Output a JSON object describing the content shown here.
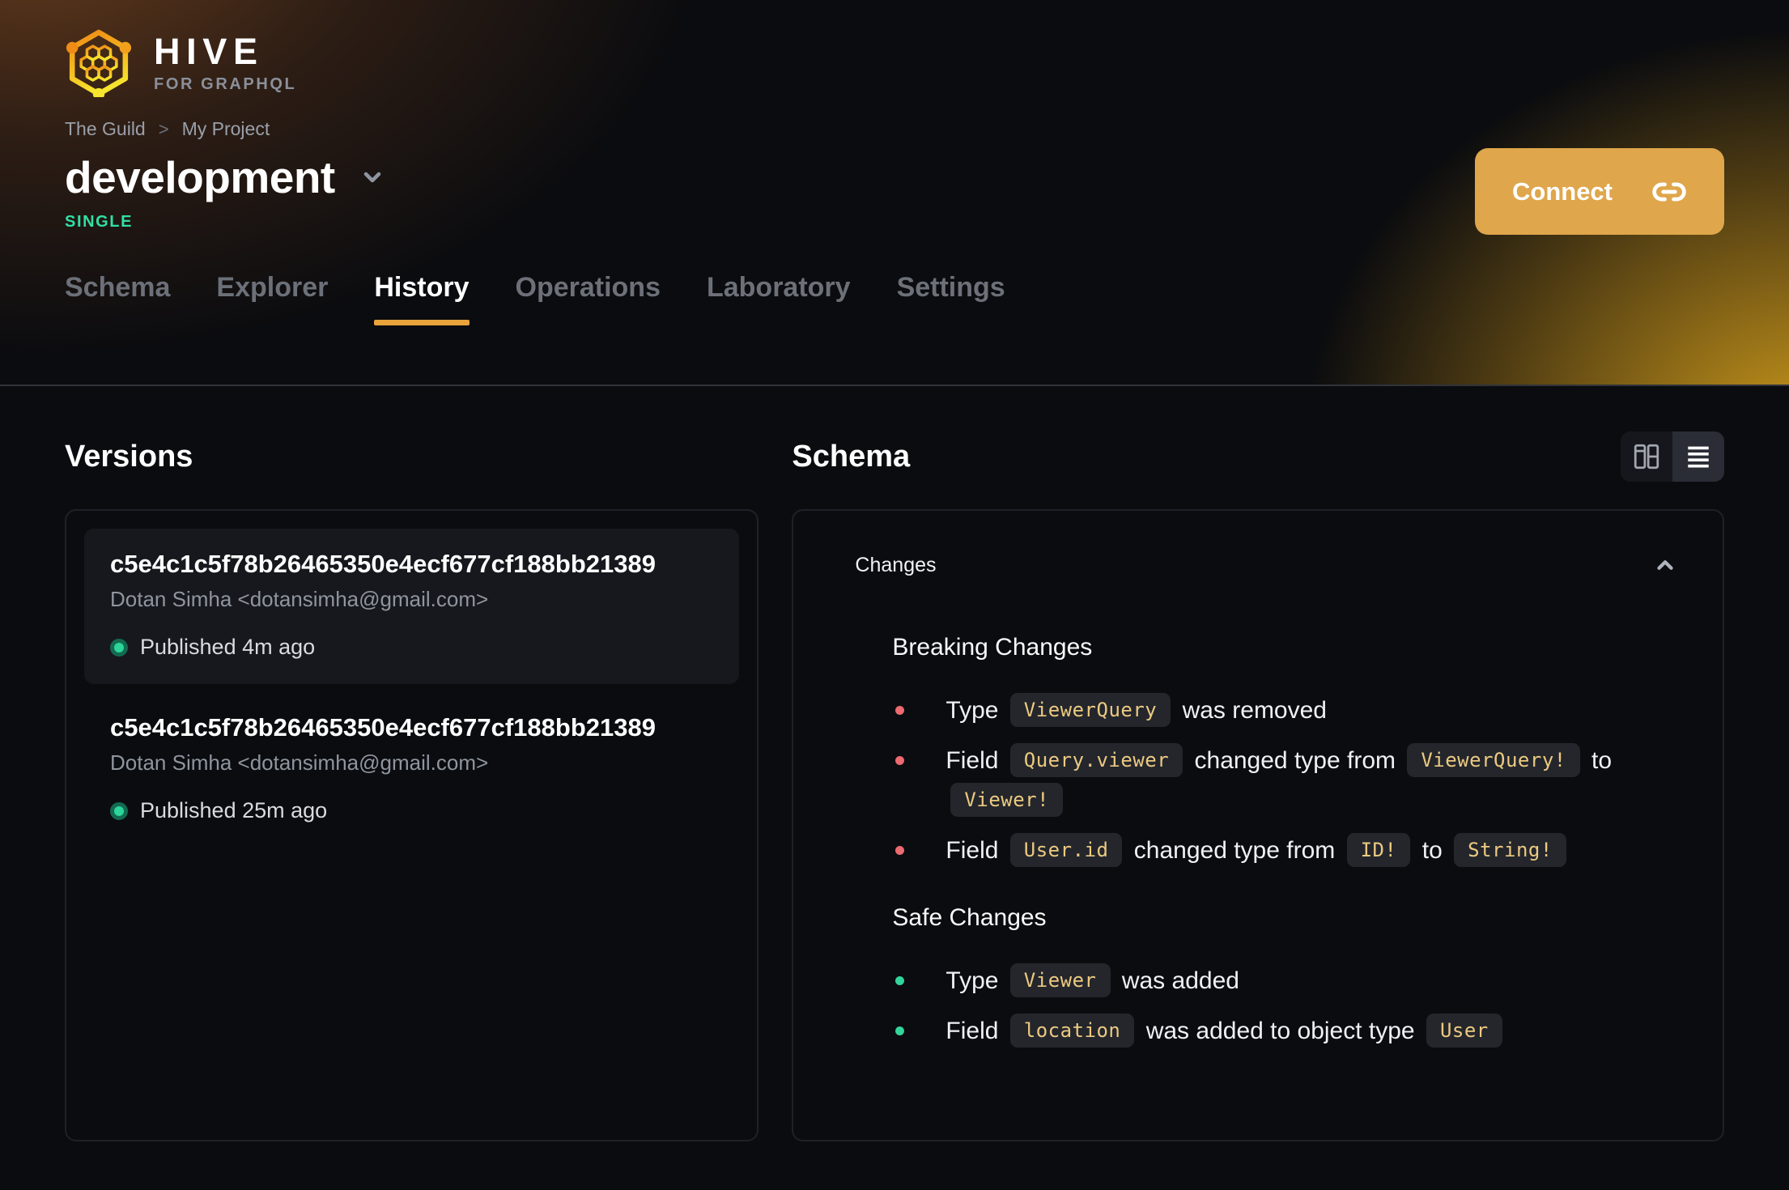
{
  "brand": {
    "name": "HIVE",
    "tagline": "FOR GRAPHQL"
  },
  "breadcrumb": {
    "org": "The Guild",
    "separator": ">",
    "project": "My Project"
  },
  "target": {
    "name": "development",
    "badge": "SINGLE"
  },
  "connect": {
    "label": "Connect",
    "icon": "link-icon"
  },
  "tabs": [
    {
      "label": "Schema",
      "active": false
    },
    {
      "label": "Explorer",
      "active": false
    },
    {
      "label": "History",
      "active": true
    },
    {
      "label": "Operations",
      "active": false
    },
    {
      "label": "Laboratory",
      "active": false
    },
    {
      "label": "Settings",
      "active": false
    }
  ],
  "versions": {
    "title": "Versions",
    "items": [
      {
        "hash": "c5e4c1c5f78b26465350e4ecf677cf188bb21389",
        "author": "Dotan Simha <dotansimha@gmail.com>",
        "status": "Published 4m ago",
        "highlighted": true
      },
      {
        "hash": "c5e4c1c5f78b26465350e4ecf677cf188bb21389",
        "author": "Dotan Simha <dotansimha@gmail.com>",
        "status": "Published 25m ago",
        "highlighted": false
      }
    ]
  },
  "schema": {
    "title": "Schema",
    "view_toggle": {
      "left_icon": "columns-view-icon",
      "right_icon": "list-view-icon",
      "active": "list"
    },
    "changes": {
      "title": "Changes",
      "collapsed": false,
      "sections": [
        {
          "title": "Breaking Changes",
          "kind": "breaking",
          "items": [
            [
              {
                "text": "Type "
              },
              {
                "code": "ViewerQuery"
              },
              {
                "text": " was removed"
              }
            ],
            [
              {
                "text": "Field "
              },
              {
                "code": "Query.viewer"
              },
              {
                "text": " changed type from "
              },
              {
                "code": "ViewerQuery!"
              },
              {
                "text": " to "
              },
              {
                "code": "Viewer!"
              }
            ],
            [
              {
                "text": "Field "
              },
              {
                "code": "User.id"
              },
              {
                "text": " changed type from "
              },
              {
                "code": "ID!"
              },
              {
                "text": " to "
              },
              {
                "code": "String!"
              }
            ]
          ]
        },
        {
          "title": "Safe Changes",
          "kind": "safe",
          "items": [
            [
              {
                "text": "Type "
              },
              {
                "code": "Viewer"
              },
              {
                "text": " was added"
              }
            ],
            [
              {
                "text": "Field "
              },
              {
                "code": "location"
              },
              {
                "text": " was added to object type "
              },
              {
                "code": "User"
              }
            ]
          ]
        }
      ]
    }
  },
  "colors": {
    "accent_amber": "#dfa64b",
    "tab_underline": "#e8a33b",
    "badge_green": "#31dfa5",
    "published_dot": "#2dd59a",
    "breaking_bullet": "#ec6a70",
    "safe_bullet": "#33d49c",
    "code_text": "#ecca80",
    "background": "#0a0c0f"
  }
}
